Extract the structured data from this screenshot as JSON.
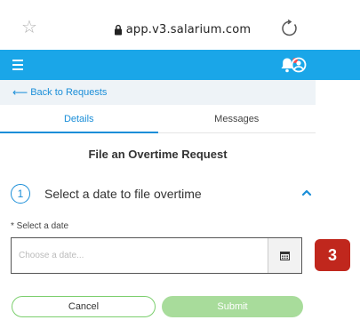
{
  "browser": {
    "url": "app.v3.salarium.com",
    "star_icon": "star-outline-icon",
    "lock_icon": "lock-icon",
    "reload_icon": "reload-icon"
  },
  "app_bar": {
    "color": "#1aa6e8",
    "menu_icon": "hamburger-menu-icon",
    "bell_icon": "bell-icon",
    "user_icon": "user-circle-icon",
    "has_notification": true
  },
  "nav": {
    "back_label": "Back to Requests"
  },
  "tabs": [
    {
      "label": "Details",
      "active": true
    },
    {
      "label": "Messages",
      "active": false
    }
  ],
  "form": {
    "title": "File an Overtime Request",
    "step": {
      "number": "1",
      "label": "Select a date to file overtime",
      "expanded": true
    },
    "date_field": {
      "label": "* Select a date",
      "placeholder": "Choose a date...",
      "value": ""
    }
  },
  "annotation": {
    "badge": "3",
    "color": "#c0271d"
  },
  "actions": {
    "cancel_label": "Cancel",
    "submit_label": "Submit",
    "submit_enabled": false,
    "accent": "#7ccf6e"
  }
}
